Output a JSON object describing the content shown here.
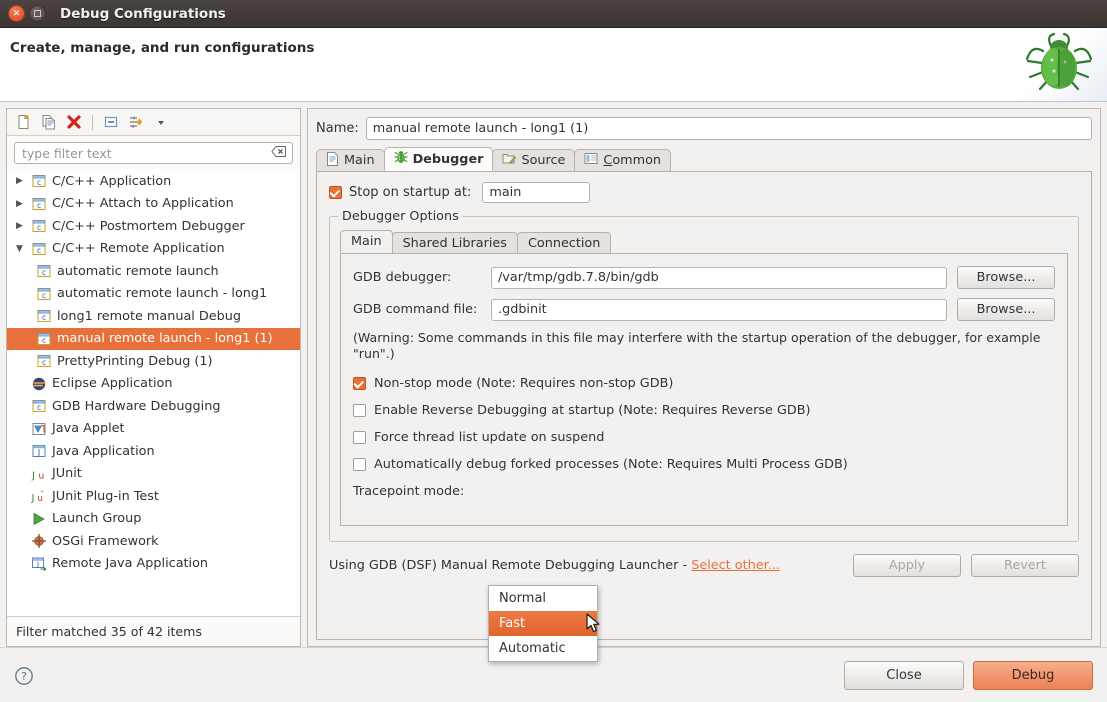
{
  "window": {
    "title": "Debug Configurations",
    "close_icon": "close-icon",
    "maximize_icon": "maximize-icon"
  },
  "banner": {
    "title": "Create, manage, and run configurations",
    "art_icon": "green-bug-icon"
  },
  "left": {
    "toolbar": [
      {
        "name": "new-configuration-icon",
        "title": "New launch configuration"
      },
      {
        "name": "duplicate-configuration-icon",
        "title": "Duplicate"
      },
      {
        "name": "delete-configuration-icon",
        "title": "Delete"
      },
      {
        "name": "collapse-all-icon",
        "title": "Collapse All"
      },
      {
        "name": "filter-icon",
        "title": "Filter launch configurations"
      },
      {
        "name": "chevron-down-icon",
        "title": "View Menu"
      }
    ],
    "filter": {
      "placeholder": "type filter text",
      "value": "",
      "clear_icon": "clear-icon"
    },
    "tree": [
      {
        "label": "C/C++ Application",
        "icon": "c-app-icon",
        "level": 0,
        "expander": "collapsed",
        "selected": false
      },
      {
        "label": "C/C++ Attach to Application",
        "icon": "c-app-icon",
        "level": 0,
        "expander": "collapsed",
        "selected": false
      },
      {
        "label": "C/C++ Postmortem Debugger",
        "icon": "c-app-icon",
        "level": 0,
        "expander": "collapsed",
        "selected": false
      },
      {
        "label": "C/C++ Remote Application",
        "icon": "c-app-icon",
        "level": 0,
        "expander": "expanded",
        "selected": false
      },
      {
        "label": "automatic remote launch",
        "icon": "c-app-icon",
        "level": 1,
        "expander": "none",
        "selected": false
      },
      {
        "label": "automatic remote launch - long1",
        "icon": "c-app-icon",
        "level": 1,
        "expander": "none",
        "selected": false
      },
      {
        "label": "long1 remote manual Debug",
        "icon": "c-app-icon",
        "level": 1,
        "expander": "none",
        "selected": false
      },
      {
        "label": "manual remote launch - long1 (1)",
        "icon": "c-app-icon",
        "level": 1,
        "expander": "none",
        "selected": true
      },
      {
        "label": "PrettyPrinting Debug (1)",
        "icon": "c-app-icon",
        "level": 1,
        "expander": "none",
        "selected": false
      },
      {
        "label": "Eclipse Application",
        "icon": "eclipse-icon",
        "level": 0,
        "expander": "none",
        "selected": false
      },
      {
        "label": "GDB Hardware Debugging",
        "icon": "c-app-icon",
        "level": 0,
        "expander": "none",
        "selected": false
      },
      {
        "label": "Java Applet",
        "icon": "java-applet-icon",
        "level": 0,
        "expander": "none",
        "selected": false
      },
      {
        "label": "Java Application",
        "icon": "java-app-icon",
        "level": 0,
        "expander": "none",
        "selected": false
      },
      {
        "label": "JUnit",
        "icon": "junit-icon",
        "level": 0,
        "expander": "none",
        "selected": false
      },
      {
        "label": "JUnit Plug-in Test",
        "icon": "junit-plugin-icon",
        "level": 0,
        "expander": "none",
        "selected": false
      },
      {
        "label": "Launch Group",
        "icon": "launch-group-icon",
        "level": 0,
        "expander": "none",
        "selected": false
      },
      {
        "label": "OSGi Framework",
        "icon": "osgi-icon",
        "level": 0,
        "expander": "none",
        "selected": false
      },
      {
        "label": "Remote Java Application",
        "icon": "remote-java-icon",
        "level": 0,
        "expander": "none",
        "selected": false
      }
    ],
    "status": "Filter matched 35 of 42 items"
  },
  "right": {
    "name_label": "Name:",
    "name_value": "manual remote launch - long1 (1)",
    "tabs": [
      {
        "label": "Main",
        "icon": "document-icon",
        "active": false
      },
      {
        "label": "Debugger",
        "icon": "bug-icon",
        "active": true
      },
      {
        "label": "Source",
        "icon": "source-folder-icon",
        "active": false
      },
      {
        "label": "Common",
        "icon": "common-icon",
        "active": false,
        "mnemonic": "C",
        "rest": "ommon"
      }
    ],
    "stop_on_startup": {
      "label": "Stop on startup at:",
      "checked": true,
      "value": "main"
    },
    "group_title": "Debugger Options",
    "inner_tabs": [
      {
        "label": "Main",
        "active": true
      },
      {
        "label": "Shared Libraries",
        "active": false
      },
      {
        "label": "Connection",
        "active": false
      }
    ],
    "fields": [
      {
        "label": "GDB debugger:",
        "value": "/var/tmp/gdb.7.8/bin/gdb",
        "button": "Browse..."
      },
      {
        "label": "GDB command file:",
        "value": ".gdbinit",
        "button": "Browse..."
      }
    ],
    "warning": "(Warning: Some commands in this file may interfere with the startup operation of the debugger, for example \"run\".)",
    "options": [
      {
        "label": "Non-stop mode (Note: Requires non-stop GDB)",
        "checked": true
      },
      {
        "label": "Enable Reverse Debugging at startup (Note: Requires Reverse GDB)",
        "checked": false
      },
      {
        "label": "Force thread list update on suspend",
        "checked": false
      },
      {
        "label": "Automatically debug forked processes (Note: Requires Multi Process GDB)",
        "checked": false
      }
    ],
    "tracepoint": {
      "label": "Tracepoint mode:",
      "selected": "Fast",
      "options": [
        {
          "label": "Normal",
          "selected": false
        },
        {
          "label": "Fast",
          "selected": true
        },
        {
          "label": "Automatic",
          "selected": false
        }
      ]
    },
    "launcher_prefix": "Using GDB (DSF) Manual Remote Debugging Launcher - ",
    "launcher_link": "Select other...",
    "apply_label": "Apply",
    "revert_label": "Revert"
  },
  "footer": {
    "help_icon": "help-icon",
    "close_label": "Close",
    "debug_label": "Debug"
  },
  "colors": {
    "accent": "#e8703a",
    "selection": "#e8703a",
    "link": "#e8703a",
    "titlebar": "#3c3532",
    "panel": "#f2f1f0"
  }
}
